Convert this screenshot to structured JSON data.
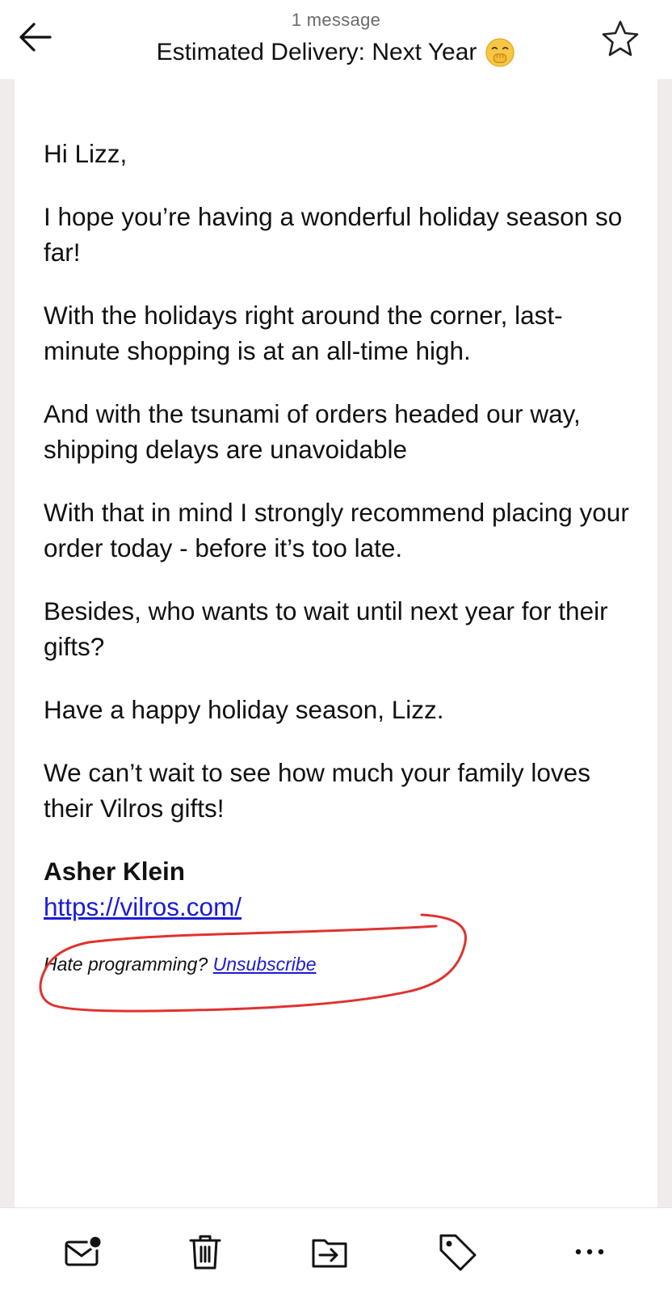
{
  "header": {
    "message_count": "1 message",
    "subject": "Estimated Delivery: Next Year",
    "emoji_icon": "hand-over-mouth-emoji",
    "back_icon": "arrow-left-icon",
    "star_icon": "star-outline-icon"
  },
  "email": {
    "greeting": "Hi Lizz,",
    "paragraphs": [
      "I hope you’re having a wonderful holiday season so far!",
      "With the holidays right around the corner, last-minute shopping is at an all-time high.",
      "And with the tsunami of orders headed our way, shipping delays are unavoidable",
      "With that in mind I strongly recommend placing your order today - before it’s too late.",
      "Besides, who wants to wait until next year for their gifts?",
      "Have a happy holiday season, Lizz.",
      "We can’t wait to see how much your family loves their Vilros gifts!"
    ],
    "signature_name": "Asher Klein",
    "signature_link": "https://vilros.com/",
    "footer_text": "Hate programming?",
    "unsubscribe_label": "Unsubscribe"
  },
  "toolbar": {
    "items": [
      {
        "icon": "mark-unread-icon"
      },
      {
        "icon": "trash-icon"
      },
      {
        "icon": "move-to-folder-icon"
      },
      {
        "icon": "tag-icon"
      },
      {
        "icon": "more-icon"
      }
    ]
  },
  "colors": {
    "link": "#1a1bd6",
    "annotation": "#e0322f",
    "gutter": "#efeceb"
  }
}
